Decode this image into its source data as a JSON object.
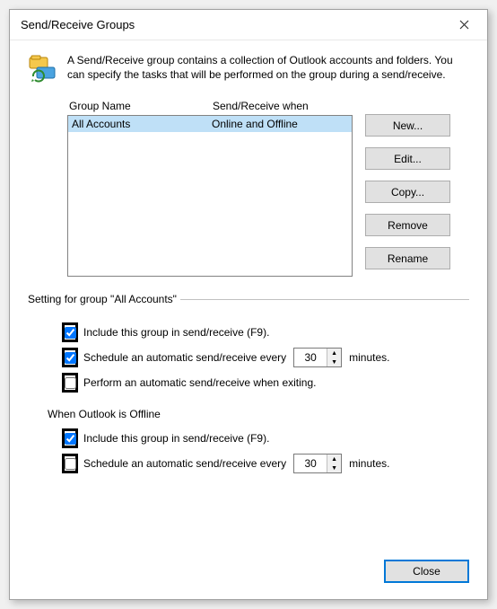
{
  "dialog": {
    "title": "Send/Receive Groups",
    "description": "A Send/Receive group contains a collection of Outlook accounts and folders. You can specify the tasks that will be performed on the group during a send/receive."
  },
  "grid": {
    "headers": {
      "name": "Group Name",
      "when": "Send/Receive when"
    },
    "rows": [
      {
        "name": "All Accounts",
        "when": "Online and Offline"
      }
    ]
  },
  "buttons": {
    "new": "New...",
    "edit": "Edit...",
    "copy": "Copy...",
    "remove": "Remove",
    "rename": "Rename",
    "close": "Close"
  },
  "settings": {
    "legend": "Setting for group \"All Accounts\"",
    "include": "Include this group in send/receive (F9).",
    "schedule": "Schedule an automatic send/receive every",
    "interval": "30",
    "minutes": "minutes.",
    "exit": "Perform an automatic send/receive when exiting."
  },
  "offline": {
    "legend": "When Outlook is Offline",
    "include": "Include this group in send/receive (F9).",
    "schedule": "Schedule an automatic send/receive every",
    "interval": "30",
    "minutes": "minutes."
  }
}
